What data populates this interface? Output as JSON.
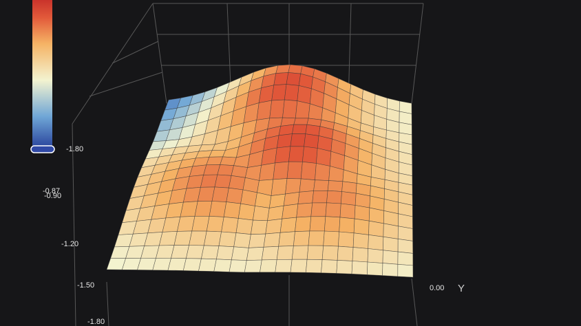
{
  "chart_data": {
    "type": "surface3d",
    "colorscale": [
      "#2e4aa0",
      "#6fa6d6",
      "#f3f3d0",
      "#f5b365",
      "#e2593a",
      "#c9332b"
    ],
    "colorbar": {
      "min_label": "-1.80"
    },
    "z_axis": {
      "ticks": [
        "-0.87",
        "-0.90",
        "-1.20",
        "-1.50",
        "-1.80"
      ]
    },
    "y_axis": {
      "title": "Y",
      "ticks": [
        "0.00"
      ]
    },
    "grid": true,
    "surface": {
      "rows": 16,
      "cols": 20,
      "peaks": [
        {
          "u": 0.5,
          "v": 0.1,
          "h": 1.0
        },
        {
          "u": 0.58,
          "v": 0.4,
          "h": 1.0
        },
        {
          "u": 0.3,
          "v": 0.58,
          "h": 0.8
        },
        {
          "u": 0.7,
          "v": 0.65,
          "h": 0.75
        }
      ]
    }
  }
}
